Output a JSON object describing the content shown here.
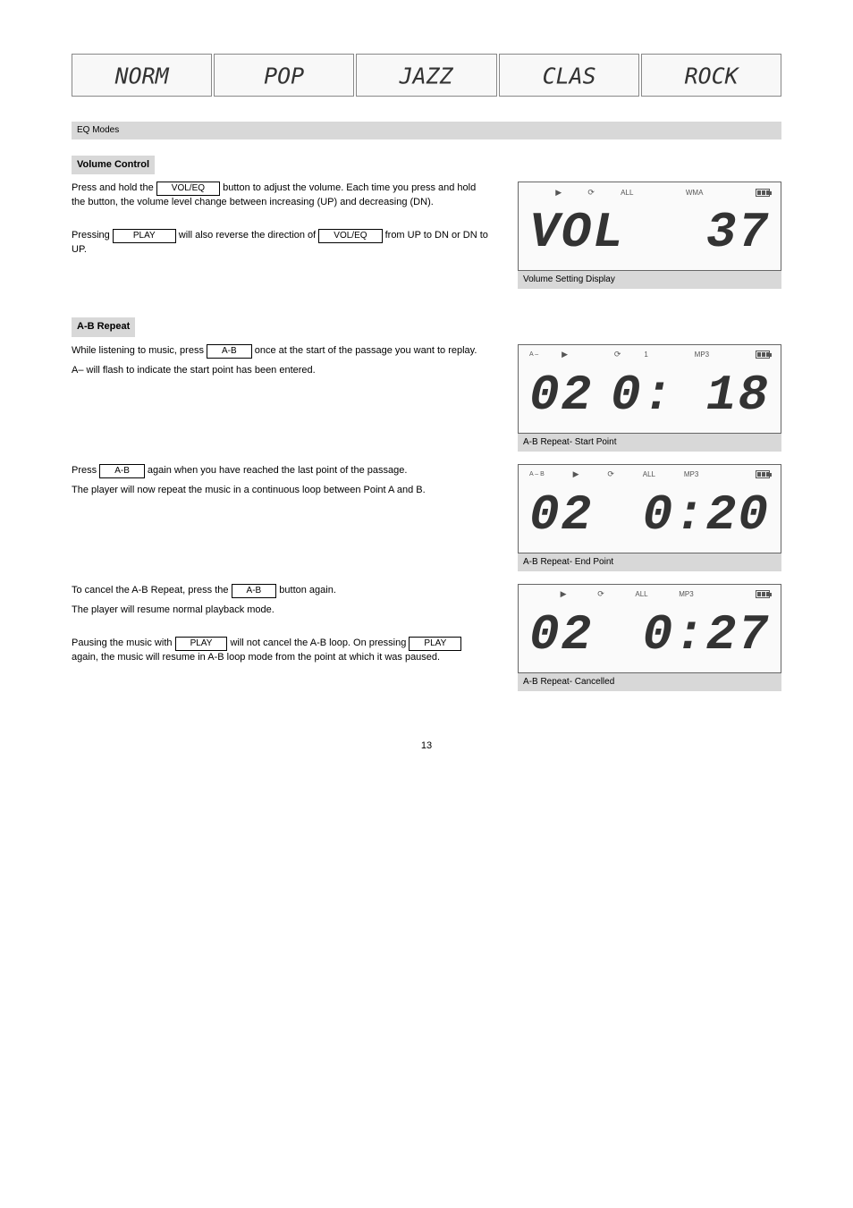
{
  "eq_modes": {
    "caption": "EQ Modes",
    "items": [
      "NORM",
      "POP",
      "JAZZ",
      "CLAS",
      "ROCK"
    ]
  },
  "volume": {
    "title": "Volume Control",
    "p1a": "Press and hold the ",
    "btn_voleq": "VOL/EQ",
    "p1b": " button to adjust the volume. Each time you press and hold the button, the volume level change between increasing (UP) and decreasing (DN).",
    "p2a": "Pressing ",
    "btn_play": "PLAY",
    "p2b": " will also reverse the direction of ",
    "p2c": " from UP to DN or DN to UP.",
    "lcd_caption": "Volume Setting Display"
  },
  "lcd_vol": {
    "top": {
      "play": "▶",
      "repeat": "⟳",
      "all": "ALL",
      "fmt": "WMA"
    },
    "left": "VOL",
    "right": "37"
  },
  "ab": {
    "title": "A-B Repeat",
    "p1a": "While listening to music, press ",
    "btn_ab": "A-B",
    "p1b": " once at the start of the passage you want to replay.",
    "p2": "A– will flash to indicate the start point has been entered.",
    "lcd1_caption": "A-B Repeat- Start Point",
    "p3a": "Press ",
    "p3b": " again when you have reached the last point of the passage.",
    "p4": "The player will now repeat the music in a continuous loop between Point A and B.",
    "lcd2_caption": "A-B Repeat- End Point",
    "p5a": "To cancel the A-B Repeat, press the ",
    "p5b": " button again.",
    "p6": "The player will resume normal playback mode.",
    "lcd3_caption": "A-B Repeat- Cancelled",
    "p7a": "Pausing the music with ",
    "p7b": " will not cancel the A-B loop. On pressing ",
    "p7c": " again, the music will resume in A-B loop mode from the point at which it was paused.",
    "btn_play2": "PLAY"
  },
  "lcd_ab1": {
    "top": {
      "ab": "A –",
      "play": "▶",
      "repeat": "⟳",
      "one": "1",
      "fmt": "MP3"
    },
    "left": "02",
    "right": "0: 18"
  },
  "lcd_ab2": {
    "top": {
      "ab": "A – B",
      "play": "▶",
      "repeat": "⟳",
      "all": "ALL",
      "fmt": "MP3"
    },
    "left": "02",
    "right": "0:20"
  },
  "lcd_ab3": {
    "top": {
      "play": "▶",
      "repeat": "⟳",
      "all": "ALL",
      "fmt": "MP3"
    },
    "left": "02",
    "right": "0:27"
  },
  "page": "13"
}
